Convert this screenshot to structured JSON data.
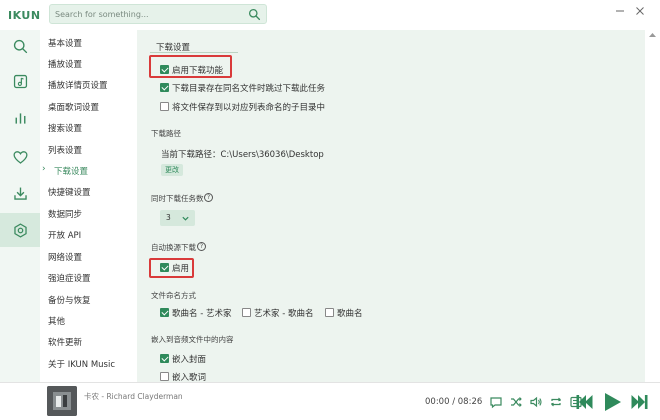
{
  "app": {
    "logo": "IKUN"
  },
  "search": {
    "placeholder": "Search for something..."
  },
  "nav": {
    "items": [
      {
        "label": "基本设置"
      },
      {
        "label": "播放设置"
      },
      {
        "label": "播放详情页设置"
      },
      {
        "label": "桌面歌词设置"
      },
      {
        "label": "搜索设置"
      },
      {
        "label": "列表设置"
      },
      {
        "label": "下载设置",
        "active": true
      },
      {
        "label": "快捷键设置"
      },
      {
        "label": "数据同步"
      },
      {
        "label": "开放 API"
      },
      {
        "label": "网络设置"
      },
      {
        "label": "强迫症设置"
      },
      {
        "label": "备份与恢复"
      },
      {
        "label": "其他"
      },
      {
        "label": "软件更新"
      },
      {
        "label": "关于 IKUN Music"
      }
    ],
    "active_chevron": "›"
  },
  "download": {
    "section_title": "下载设置",
    "enable_label": "启用下载功能",
    "enable_checked": true,
    "skip_existing_label": "下载目录存在同名文件时跳过下载此任务",
    "skip_existing_checked": true,
    "subfolder_label": "将文件保存到以对应列表命名的子目录中",
    "subfolder_checked": false,
    "path_title": "下载路径",
    "current_path_label": "当前下载路径：C:\\Users\\36036\\Desktop",
    "change_button": "更改",
    "concurrent_title": "同时下载任务数",
    "concurrent_value": "3",
    "auto_source_title": "自动换源下载",
    "auto_source_enable_label": "启用",
    "auto_source_checked": true,
    "naming_title": "文件命名方式",
    "naming_options": [
      {
        "label": "歌曲名 - 艺术家",
        "checked": true
      },
      {
        "label": "艺术家 - 歌曲名",
        "checked": false
      },
      {
        "label": "歌曲名",
        "checked": false
      }
    ],
    "embed_title": "嵌入到音频文件中的内容",
    "embed_options": [
      {
        "label": "嵌入封面",
        "checked": true
      },
      {
        "label": "嵌入歌词",
        "checked": false
      }
    ],
    "help_glyph": "?"
  },
  "player": {
    "song": "卡农 - Richard Clayderman",
    "time": "00:00 / 08:26"
  },
  "colors": {
    "accent": "#2f8a5b",
    "highlight": "#d93a3a",
    "panel_bg": "#edf4ef",
    "rail_bg": "#f1f7f3"
  },
  "icons": {
    "rail": [
      "search-icon",
      "music-note-icon",
      "bar-chart-icon",
      "heart-icon",
      "download-icon",
      "gear-icon"
    ],
    "player": [
      "comment-icon",
      "shuffle-icon",
      "volume-icon",
      "repeat-icon",
      "lyrics-icon",
      "previous-icon",
      "play-icon",
      "next-icon"
    ]
  }
}
